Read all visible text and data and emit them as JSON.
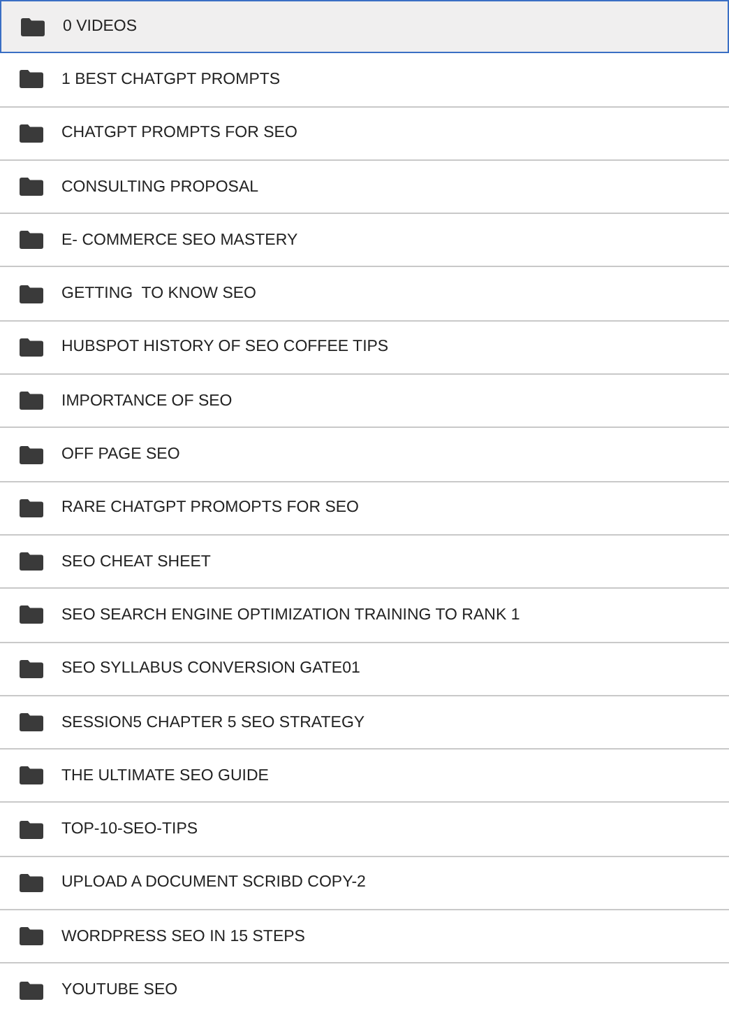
{
  "folders": [
    {
      "name": "0 VIDEOS",
      "selected": true
    },
    {
      "name": "1 BEST CHATGPT PROMPTS",
      "selected": false
    },
    {
      "name": "CHATGPT PROMPTS FOR SEO",
      "selected": false
    },
    {
      "name": "CONSULTING PROPOSAL",
      "selected": false
    },
    {
      "name": "E- COMMERCE SEO MASTERY",
      "selected": false
    },
    {
      "name": "GETTING  TO KNOW SEO",
      "selected": false
    },
    {
      "name": "HUBSPOT HISTORY OF SEO COFFEE TIPS",
      "selected": false
    },
    {
      "name": "IMPORTANCE OF SEO",
      "selected": false
    },
    {
      "name": "OFF PAGE SEO",
      "selected": false
    },
    {
      "name": "RARE CHATGPT PROMOPTS FOR SEO",
      "selected": false
    },
    {
      "name": "SEO CHEAT SHEET",
      "selected": false
    },
    {
      "name": "SEO SEARCH ENGINE OPTIMIZATION TRAINING TO RANK 1",
      "selected": false
    },
    {
      "name": "SEO SYLLABUS CONVERSION GATE01",
      "selected": false
    },
    {
      "name": "SESSION5 CHAPTER 5 SEO STRATEGY",
      "selected": false
    },
    {
      "name": "THE ULTIMATE SEO GUIDE",
      "selected": false
    },
    {
      "name": "TOP-10-SEO-TIPS",
      "selected": false
    },
    {
      "name": "UPLOAD A DOCUMENT SCRIBD COPY-2",
      "selected": false
    },
    {
      "name": "WORDPRESS SEO IN 15 STEPS",
      "selected": false
    },
    {
      "name": "YOUTUBE SEO",
      "selected": false
    }
  ]
}
